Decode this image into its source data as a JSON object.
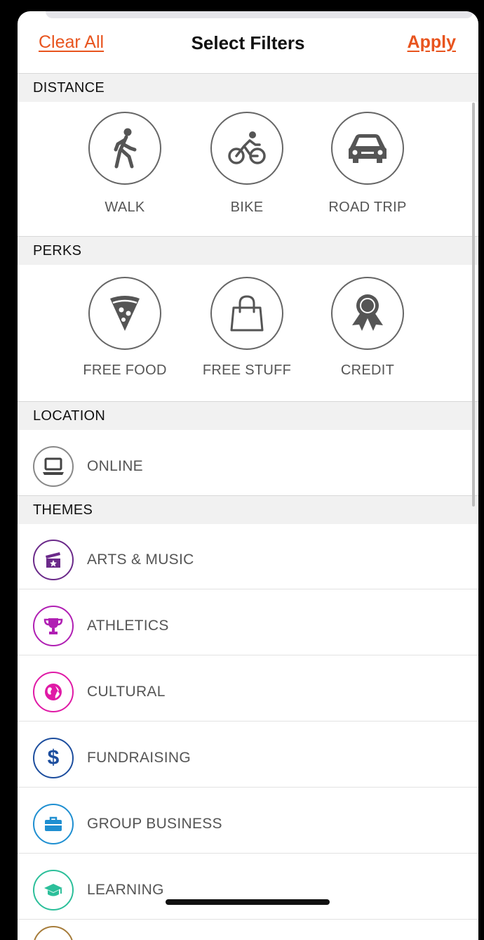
{
  "header": {
    "clear_label": "Clear All",
    "title": "Select Filters",
    "apply_label": "Apply"
  },
  "sections": {
    "distance": {
      "title": "DISTANCE",
      "options": [
        {
          "label": "WALK",
          "icon": "walk-icon"
        },
        {
          "label": "BIKE",
          "icon": "bike-icon"
        },
        {
          "label": "ROAD TRIP",
          "icon": "car-icon"
        }
      ]
    },
    "perks": {
      "title": "PERKS",
      "options": [
        {
          "label": "FREE FOOD",
          "icon": "pizza-icon"
        },
        {
          "label": "FREE STUFF",
          "icon": "shopping-bag-icon"
        },
        {
          "label": "CREDIT",
          "icon": "award-ribbon-icon"
        }
      ]
    },
    "location": {
      "title": "LOCATION",
      "items": [
        {
          "label": "ONLINE",
          "icon": "laptop-icon"
        }
      ]
    },
    "themes": {
      "title": "THEMES",
      "items": [
        {
          "label": "ARTS & MUSIC",
          "icon": "film-clapper-icon",
          "color": "#6b2a8a"
        },
        {
          "label": "ATHLETICS",
          "icon": "trophy-icon",
          "color": "#b01fb3"
        },
        {
          "label": "CULTURAL",
          "icon": "globe-icon",
          "color": "#e01aa6"
        },
        {
          "label": "FUNDRAISING",
          "icon": "dollar-icon",
          "color": "#1d4e9e"
        },
        {
          "label": "GROUP BUSINESS",
          "icon": "briefcase-icon",
          "color": "#1f8fd1"
        },
        {
          "label": "LEARNING",
          "icon": "graduation-cap-icon",
          "color": "#2cbf9a"
        }
      ]
    }
  }
}
